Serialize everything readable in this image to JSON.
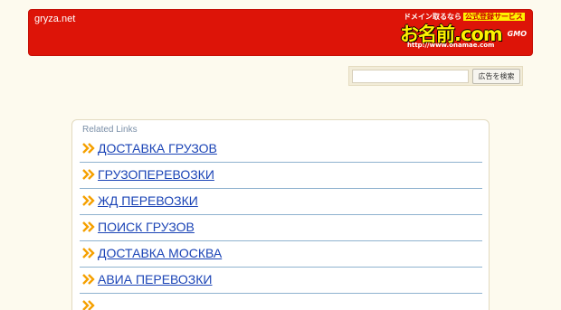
{
  "header": {
    "domain": "gryza.net",
    "ad": {
      "line1": "ドメイン取るなら",
      "line1_box": "公式登録サービス",
      "brand": "お名前.com",
      "url": "http://www.onamae.com",
      "gmo": "GMO"
    },
    "bg_color": "#dd1408"
  },
  "search": {
    "placeholder": "",
    "button_label": "広告を検索"
  },
  "related": {
    "title": "Related Links",
    "items": [
      {
        "label": "ДОСТАВКА ГРУЗОВ"
      },
      {
        "label": "ГРУЗОПЕРЕВОЗКИ"
      },
      {
        "label": "ЖД ПЕРЕВОЗКИ"
      },
      {
        "label": "ПОИСК ГРУЗОВ"
      },
      {
        "label": "ДОСТАВКА МОСКВА"
      },
      {
        "label": "АВИА ПЕРЕВОЗКИ"
      },
      {
        "label": ""
      }
    ],
    "arrow_icon": "double-chevron-right-icon",
    "arrow_color": "#f5a000",
    "link_color": "#1b44b6"
  }
}
